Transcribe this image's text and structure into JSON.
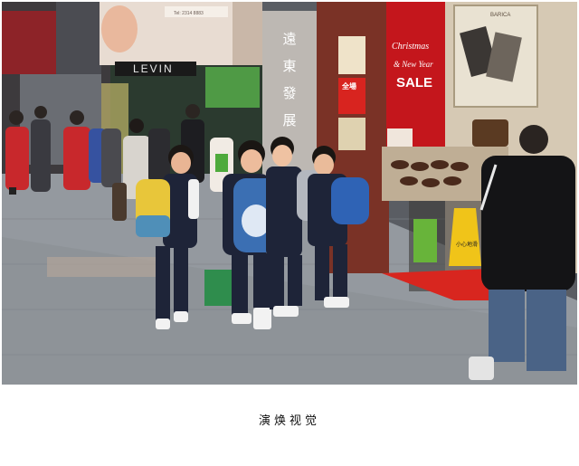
{
  "photo": {
    "scene": "Street scene",
    "billboard_contact": "Tel: 2314 8883",
    "store_sign": "LEVIN",
    "vertical_sign": [
      "遠",
      "東",
      "發",
      "展"
    ],
    "window_promo_top": "Christmas",
    "window_promo_mid": "& New Year",
    "window_promo_sale": "SALE",
    "window_chinese_sign": "全場",
    "brand_sign": "BARICA",
    "caution_sign": "小心地滑"
  },
  "caption": "演焕视觉",
  "colors": {
    "pavement": "#8e9398",
    "store_red": "#c4161c",
    "backpack_blue": "#3b6fb3",
    "uniform_navy": "#1e2438"
  }
}
